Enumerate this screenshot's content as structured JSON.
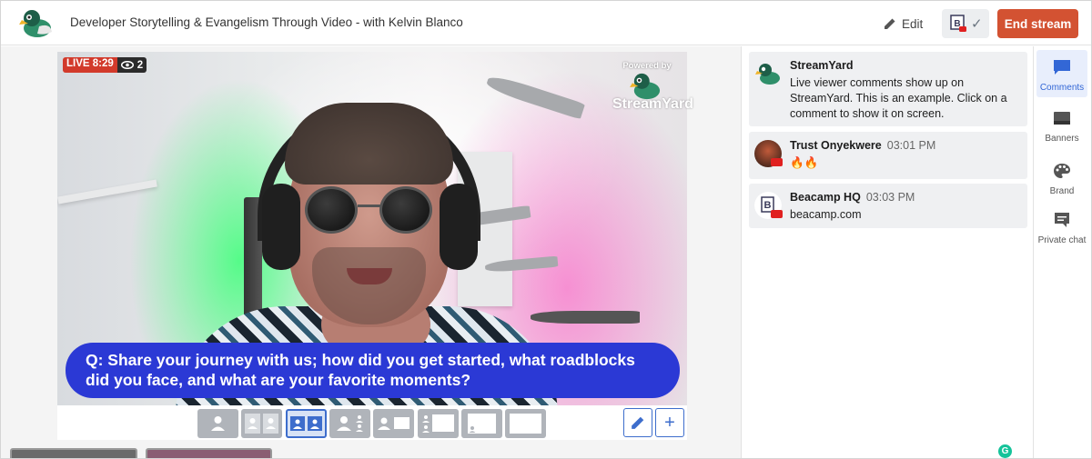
{
  "header": {
    "title": "Developer Storytelling & Evangelism Through Video - with Kelvin Blanco",
    "edit_label": "Edit",
    "end_stream_label": "End stream"
  },
  "stage": {
    "live_label": "LIVE 8:29",
    "viewer_count": "2",
    "powered_by": "Powered by",
    "brand_text": "StreamYard",
    "banner_text": "Q: Share your journey with us; how did you get started, what roadblocks did you face, and what are your favorite moments?"
  },
  "layouts": [
    {
      "name": "solo"
    },
    {
      "name": "thin-split"
    },
    {
      "name": "group",
      "selected": true
    },
    {
      "name": "leader"
    },
    {
      "name": "news"
    },
    {
      "name": "screen-sidebar"
    },
    {
      "name": "screen-small"
    },
    {
      "name": "screen-only"
    }
  ],
  "comments": [
    {
      "author": "StreamYard",
      "time": "",
      "text": "Live viewer comments show up on StreamYard. This is an example. Click on a comment to show it on screen."
    },
    {
      "author": "Trust Onyekwere",
      "time": "03:01 PM",
      "text": "🔥🔥"
    },
    {
      "author": "Beacamp HQ",
      "time": "03:03 PM",
      "text": "beacamp.com"
    }
  ],
  "rail": {
    "comments": "Comments",
    "banners": "Banners",
    "brand": "Brand",
    "private_chat": "Private chat"
  },
  "colors": {
    "end_stream": "#d35232",
    "banner": "#2b39d5",
    "accent": "#3367d6",
    "live": "#d23a2b"
  }
}
